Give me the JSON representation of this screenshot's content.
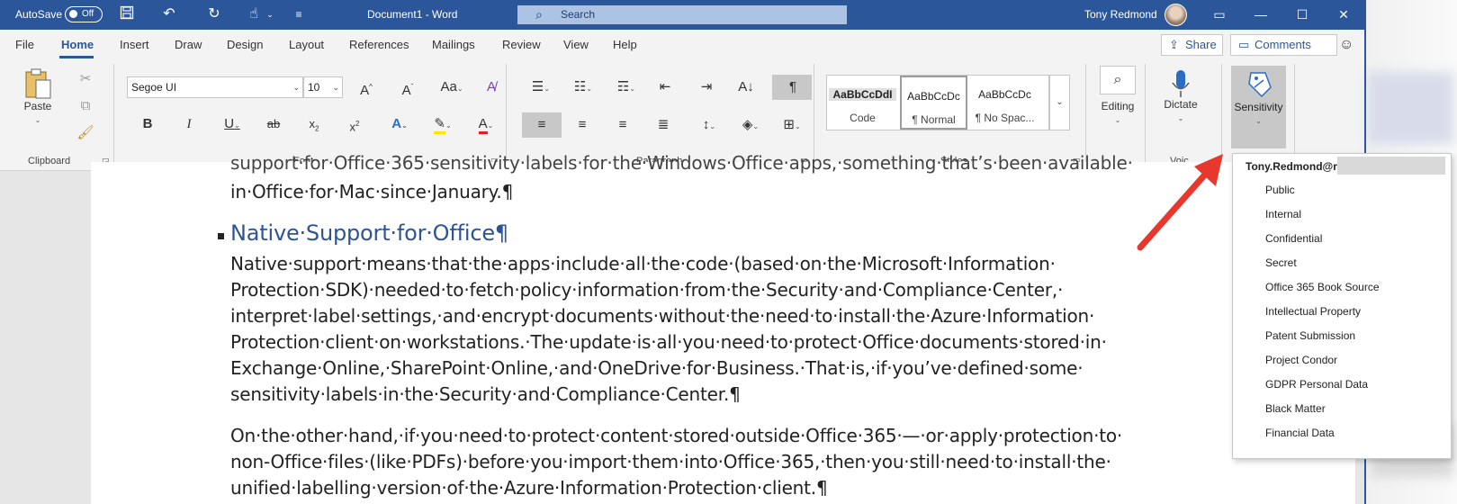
{
  "titlebar": {
    "autosave_label": "AutoSave",
    "autosave_state": "Off",
    "document_title": "Document1  -  Word",
    "search_placeholder": "Search",
    "user_name": "Tony Redmond"
  },
  "ribbon": {
    "tabs": [
      "File",
      "Home",
      "Insert",
      "Draw",
      "Design",
      "Layout",
      "References",
      "Mailings",
      "Review",
      "View",
      "Help"
    ],
    "active_tab": "Home",
    "share_label": "Share",
    "comments_label": "Comments",
    "clipboard": {
      "paste_label": "Paste",
      "group_label": "Clipboard"
    },
    "font": {
      "family": "Segoe UI",
      "size": "10",
      "group_label": "Font"
    },
    "paragraph": {
      "group_label": "Paragraph"
    },
    "styles": {
      "group_label": "Styles",
      "items": [
        {
          "sample": "AaBbCcDdI",
          "name": "Code"
        },
        {
          "sample": "AaBbCcDc",
          "name": "¶ Normal"
        },
        {
          "sample": "AaBbCcDc",
          "name": "¶ No Spac..."
        }
      ]
    },
    "editing_label": "Editing",
    "dictate_label": "Dictate",
    "voice_group_label": "Voic",
    "sensitivity_label": "Sensitivity"
  },
  "document": {
    "lines": [
      {
        "text": "support·for·Office·365·sensitivity·labels·for·the·Windows·Office·apps,·something·that’s·been·available·"
      },
      {
        "text": "in·Office·for·Mac·since·January.¶"
      },
      {
        "text": "Native·Support·for·Office¶"
      },
      {
        "text": "Native·support·means·that·the·apps·include·all·the·code·(based·on·the·Microsoft·Information·"
      },
      {
        "text": "Protection·SDK)·needed·to·fetch·policy·information·from·the·Security·and·Compliance·Center,·"
      },
      {
        "text": "interpret·label·settings,·and·encrypt·documents·without·the·need·to·install·the·Azure·Information·"
      },
      {
        "text": "Protection·client·on·workstations.·The·update·is·all·you·need·to·protect·Office·documents·stored·in·"
      },
      {
        "text": "Exchange·Online,·SharePoint·Online,·and·OneDrive·for·Business.·That·is,·if·you’ve·defined·some·"
      },
      {
        "text": "sensitivity·labels·in·the·Security·and·Compliance·Center.¶"
      },
      {
        "text": "On·the·other·hand,·if·you·need·to·protect·content·stored·outside·Office·365·—·or·apply·protection·to·"
      },
      {
        "text": "non-Office·files·(like·PDFs)·before·you·import·them·into·Office·365,·then·you·still·need·to·install·the·"
      },
      {
        "text": "unified·labelling·version·of·the·Azure·Information·Protection·client.¶"
      }
    ]
  },
  "sensitivity_menu": {
    "account": "Tony.Redmond@re",
    "items": [
      "Public",
      "Internal",
      "Confidential",
      "Secret",
      "Office 365 Book Source",
      "Intellectual Property",
      "Patent Submission",
      "Project Condor",
      "GDPR Personal Data",
      "Black Matter",
      "Financial Data"
    ]
  },
  "colors": {
    "title_bar": "#2b579a",
    "heading": "#2f5496",
    "annotation_arrow": "#e8372c"
  }
}
